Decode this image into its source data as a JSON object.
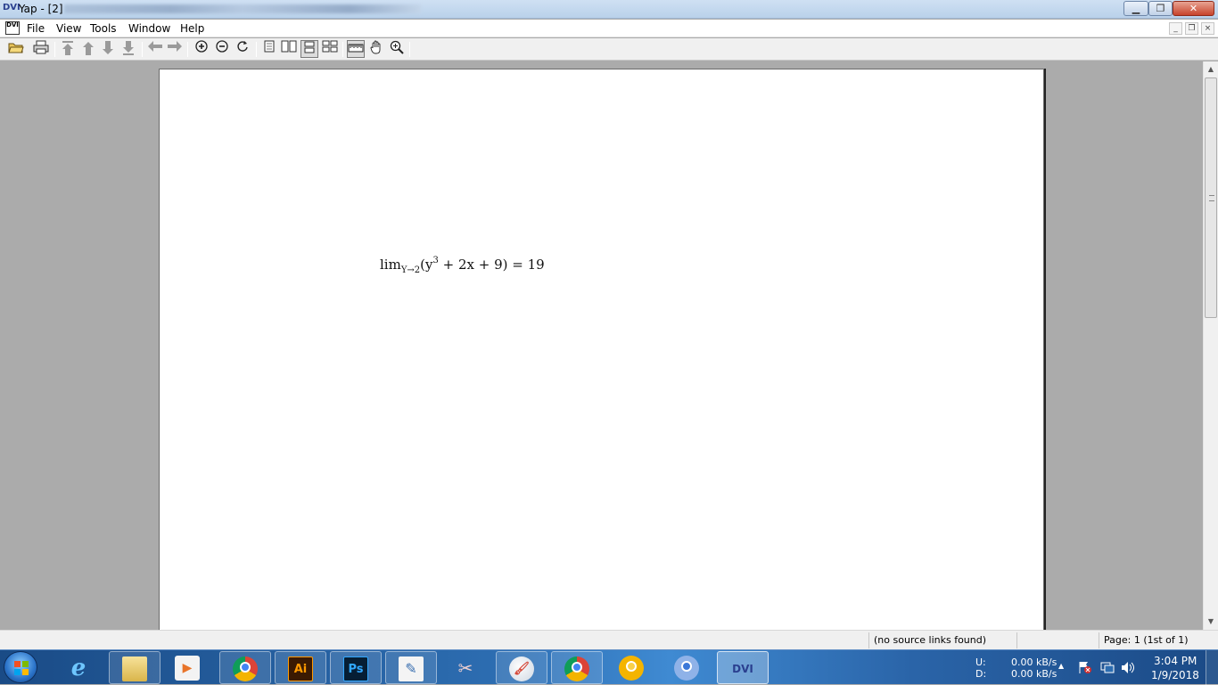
{
  "window": {
    "title": "Yap - [2]",
    "buttons": {
      "minimize": "▁",
      "maximize": "❐",
      "close": "✕"
    }
  },
  "menu": {
    "items": [
      "File",
      "View",
      "Tools",
      "Window",
      "Help"
    ],
    "mdi": {
      "minimize": "_",
      "restore": "❐",
      "close": "×"
    }
  },
  "toolbar": {
    "icons": [
      "open-icon",
      "print-icon",
      "first-page-icon",
      "previous-page-icon",
      "next-page-icon",
      "last-page-icon",
      "back-icon",
      "forward-icon",
      "zoom-in-icon",
      "zoom-out-icon",
      "refresh-icon",
      "single-page-icon",
      "double-page-icon",
      "continuous-icon",
      "book-view-icon",
      "ruler-icon",
      "hand-tool-icon",
      "magnifier-icon"
    ]
  },
  "document": {
    "formula": {
      "lim": "lim",
      "subscript": "Y→2",
      "open": "(y",
      "superscript": "3",
      "rest": " + 2x + 9) = 19"
    }
  },
  "status": {
    "source_links": "(no source links found)",
    "page": "Page: 1 (1st of 1)"
  },
  "taskbar": {
    "apps": [
      "Internet Explorer",
      "File Explorer",
      "Media Player",
      "Google Chrome",
      "Adobe Illustrator",
      "Adobe Photoshop",
      "Tool",
      "Snipping Tool",
      "Paint",
      "Chrome Beta",
      "Chrome Canary",
      "Chromium",
      "Yap"
    ],
    "labels": {
      "illustrator": "Ai",
      "photoshop": "Ps",
      "yap": "DVI"
    },
    "network": {
      "upload_label": "U:",
      "download_label": "D:",
      "upload": "0.00 kB/s",
      "download": "0.00 kB/s"
    },
    "tray_arrow": "▲",
    "clock": {
      "time": "3:04 PM",
      "date": "1/9/2018"
    }
  },
  "colors": {
    "taskbar": "#2c6cb0",
    "titlebar": "#c3d8ef",
    "viewport": "#ababab"
  }
}
